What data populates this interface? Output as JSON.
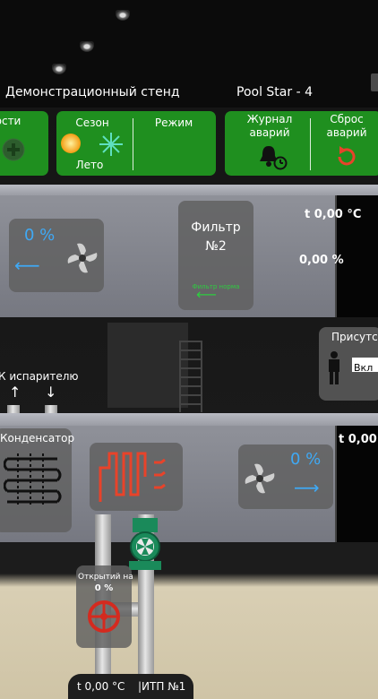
{
  "header": {
    "stand_title": "Демонстрационный стенд",
    "device": "Pool Star - 4"
  },
  "toolbar": {
    "left_cut_label": "ости",
    "season_label": "Сезон",
    "season_value": "Лето",
    "mode_label": "Режим",
    "alarm_log_label_1": "Журнал",
    "alarm_log_label_2": "аварий",
    "reset_label_1": "Сброс",
    "reset_label_2": "аварий"
  },
  "supply_duct": {
    "fan_percent": "0 %",
    "filter_title_1": "Фильтр",
    "filter_title_2": "№2",
    "filter_status": "Фильтр норма",
    "temperature": "t 0,00 °C",
    "humidity": "0,00 %"
  },
  "middle": {
    "presence_label": "Присутст",
    "presence_value": "Вкл",
    "evaporator_label": "К испарителю"
  },
  "exhaust_duct": {
    "condenser_label": "Конденсатор",
    "fan_percent": "0 %",
    "temperature": "t 0,00"
  },
  "valve": {
    "label": "Открытий на",
    "percent": "0 %"
  },
  "bottom": {
    "temperature": "t 0,00 °C",
    "itp": "|ИТП №1"
  },
  "colors": {
    "green": "#1f8f1f",
    "accent_blue": "#3fa9f5",
    "accent_red": "#e8432a"
  }
}
